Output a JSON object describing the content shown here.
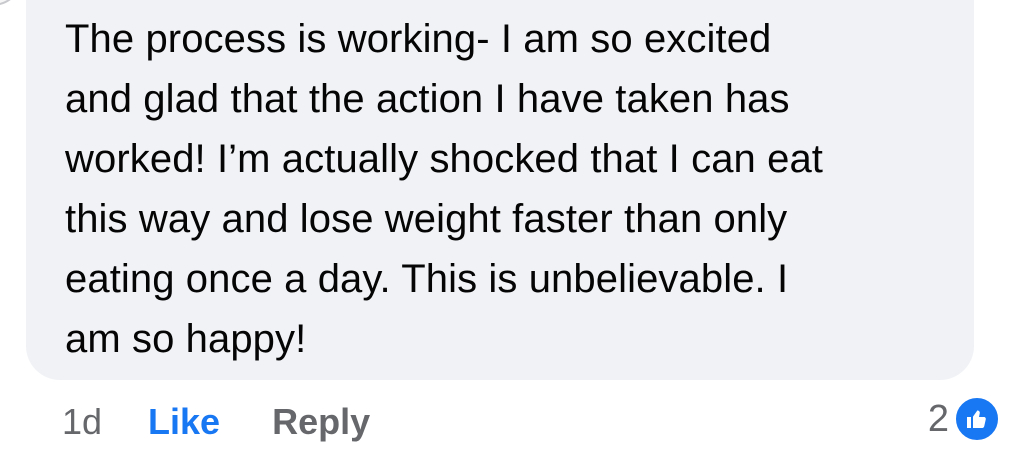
{
  "comment": {
    "text": "The process is working- I am so excited\nand glad that the action I have taken has\nworked! I’m actually shocked that I can eat\nthis way and lose weight faster than only\neating once a day. This is unbelievable. I\nam so happy!"
  },
  "actions": {
    "timestamp": "1d",
    "like_label": "Like",
    "reply_label": "Reply"
  },
  "reactions": {
    "count": "2",
    "icon": "thumbs-up-icon",
    "color": "#1877f2"
  },
  "colors": {
    "bubble": "#f0f2f5",
    "link_blue": "#1877f2",
    "secondary_text": "#65676b",
    "primary_text": "#050505"
  }
}
